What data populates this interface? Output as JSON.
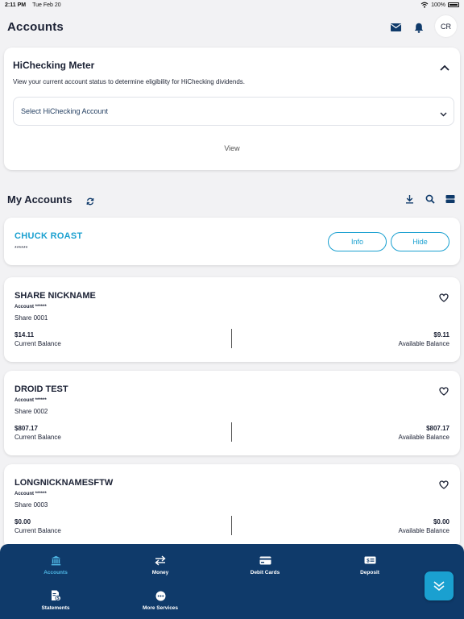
{
  "status_bar": {
    "time": "2:11 PM",
    "date": "Tue Feb 20",
    "battery": "100%"
  },
  "header": {
    "title": "Accounts",
    "avatar_initials": "CR"
  },
  "meter": {
    "title": "HiChecking Meter",
    "description": "View your current account status to determine eligibility for HiChecking dividends.",
    "select_label": "Select HiChecking Account",
    "view_label": "View"
  },
  "my_accounts": {
    "title": "My Accounts"
  },
  "member": {
    "name": "CHUCK ROAST",
    "masked": "******",
    "info_label": "Info",
    "hide_label": "Hide"
  },
  "accounts": [
    {
      "name": "SHARE NICKNAME",
      "account": "Account ******",
      "share": "Share 0001",
      "current_balance": "$14.11",
      "current_label": "Current Balance",
      "available_balance": "$9.11",
      "available_label": "Available Balance"
    },
    {
      "name": "DROID TEST",
      "account": "Account ******",
      "share": "Share 0002",
      "current_balance": "$807.17",
      "current_label": "Current Balance",
      "available_balance": "$807.17",
      "available_label": "Available Balance"
    },
    {
      "name": "LONGNICKNAMESFTW",
      "account": "Account ******",
      "share": "Share 0003",
      "current_balance": "$0.00",
      "current_label": "Current Balance",
      "available_balance": "$0.00",
      "available_label": "Available Balance"
    }
  ],
  "nav": {
    "items": [
      {
        "label": "Accounts",
        "icon": "bank-icon"
      },
      {
        "label": "Money",
        "icon": "transfer-icon"
      },
      {
        "label": "Debit Cards",
        "icon": "card-icon"
      },
      {
        "label": "Deposit",
        "icon": "check-deposit-icon"
      },
      {
        "label": "Statements",
        "icon": "statement-icon"
      },
      {
        "label": "More Services",
        "icon": "more-icon"
      }
    ]
  },
  "colors": {
    "accent": "#1aa0d0",
    "nav_bg": "#0f3a6a",
    "text_dark": "#1b2134",
    "page_bg": "#f2f2f4"
  }
}
